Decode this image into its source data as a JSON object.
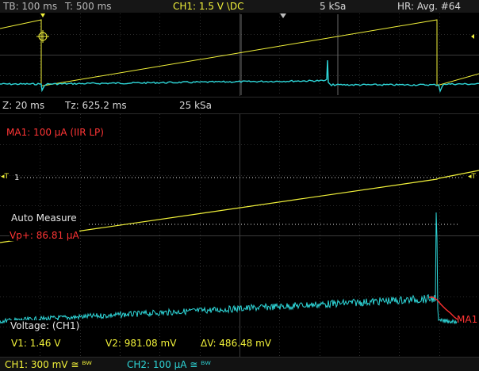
{
  "top_bar": {
    "timebase": "TB: 100 ms",
    "trigger_time": "T: 500 ms",
    "ch1_setting": "CH1: 1.5 V \\DC",
    "sample_rate": "5 kSa",
    "acquisition": "HR: Avg. #64"
  },
  "zoom_bar": {
    "zoom": "Z: 20 ms",
    "zoom_time": "Tz: 625.2 ms",
    "zoom_rate": "25 kSa"
  },
  "math": {
    "label": "MA1: 100 µA (IIR LP)",
    "trace_marker": "MA1"
  },
  "markers": {
    "trigger_level_left": "T",
    "trigger_index": "1",
    "trigger_level_right": "T"
  },
  "auto_measure": {
    "title": "Auto Measure",
    "vp_plus": "Vp+: 86.81 µA"
  },
  "cursors": {
    "title": "Voltage: (CH1)",
    "v1": "V1: 1.46 V",
    "v2": "V2: 981.08 mV",
    "dv": "ΔV: 486.48 mV"
  },
  "bottom_bar": {
    "ch1": "CH1: 300 mV ≅ ᴮᵂ",
    "ch2": "CH2: 100 µA ≅ ᴮᵂ"
  },
  "colors": {
    "ch1": "#f2f23a",
    "ch2": "#2ed6d8",
    "math": "#ff3030",
    "grid": "#3a3a3a",
    "text": "#cfcfcf"
  }
}
